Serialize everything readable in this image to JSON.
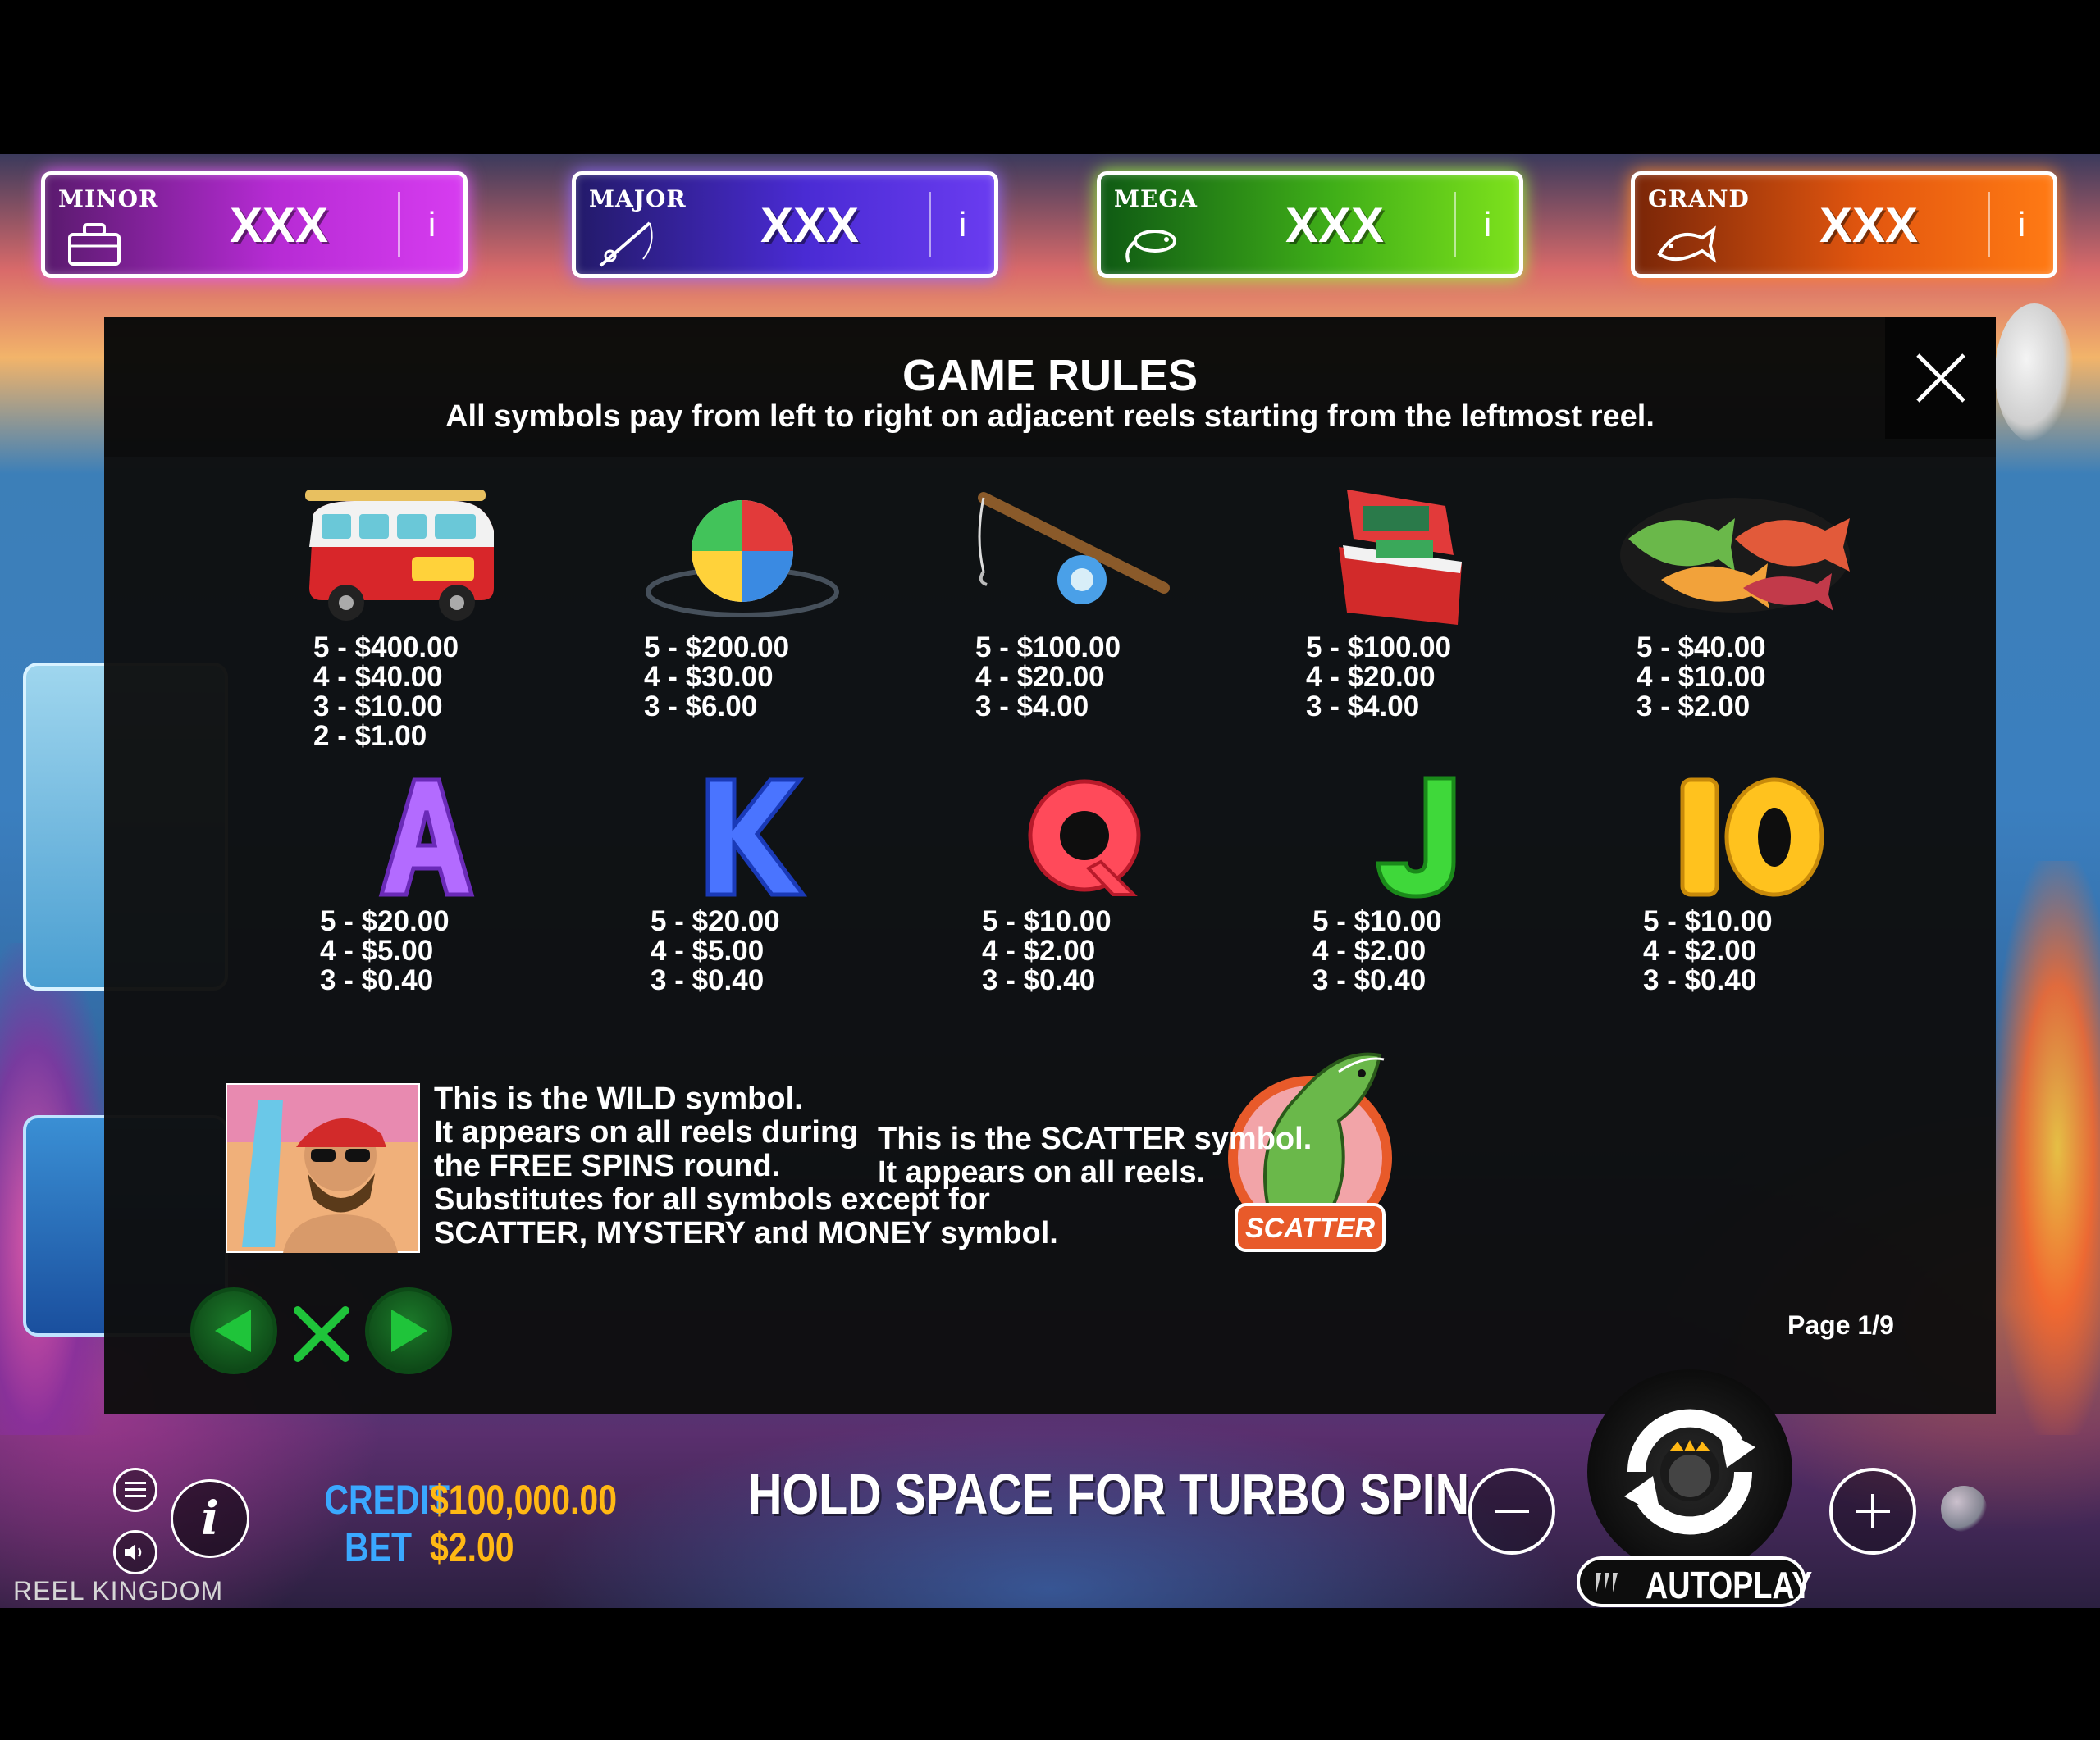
{
  "jackpots": [
    {
      "name": "MINOR",
      "value": "XXX",
      "info": "i",
      "icon": "tackle-box-icon"
    },
    {
      "name": "MAJOR",
      "value": "XXX",
      "info": "i",
      "icon": "fishing-rod-icon"
    },
    {
      "name": "MEGA",
      "value": "XXX",
      "info": "i",
      "icon": "fishing-lure-icon"
    },
    {
      "name": "GRAND",
      "value": "XXX",
      "info": "i",
      "icon": "fish-icon"
    }
  ],
  "rules": {
    "title": "GAME RULES",
    "subtitle": "All symbols pay from left to right on adjacent reels starting from the leftmost reel.",
    "close_icon": "close-icon",
    "symbols_row1": [
      {
        "name": "van",
        "pays": [
          "5 - $400.00",
          "4 - $40.00",
          "3 - $10.00",
          "2 - $1.00"
        ]
      },
      {
        "name": "beach-ball",
        "pays": [
          "5 - $200.00",
          "4 - $30.00",
          "3 - $6.00"
        ]
      },
      {
        "name": "fishing-rod",
        "pays": [
          "5 - $100.00",
          "4 - $20.00",
          "3 - $4.00"
        ]
      },
      {
        "name": "tackle-box",
        "pays": [
          "5 - $100.00",
          "4 - $20.00",
          "3 - $4.00"
        ]
      },
      {
        "name": "fish",
        "pays": [
          "5 - $40.00",
          "4 - $10.00",
          "3 - $2.00"
        ]
      }
    ],
    "symbols_row2": [
      {
        "name": "A",
        "pays": [
          "5 - $20.00",
          "4 - $5.00",
          "3 - $0.40"
        ],
        "color": "#b36bff"
      },
      {
        "name": "K",
        "pays": [
          "5 - $20.00",
          "4 - $5.00",
          "3 - $0.40"
        ],
        "color": "#4a74ff"
      },
      {
        "name": "Q",
        "pays": [
          "5 - $10.00",
          "4 - $2.00",
          "3 - $0.40"
        ],
        "color": "#ff4a5a"
      },
      {
        "name": "J",
        "pays": [
          "5 - $10.00",
          "4 - $2.00",
          "3 - $0.40"
        ],
        "color": "#3fd83a"
      },
      {
        "name": "10",
        "pays": [
          "5 - $10.00",
          "4 - $2.00",
          "3 - $0.40"
        ],
        "color": "#ffc21e"
      }
    ],
    "wild": {
      "lines": [
        "This is the WILD symbol.",
        "It appears on all reels during",
        "the FREE SPINS round.",
        "Substitutes for all symbols except for",
        "SCATTER, MYSTERY and MONEY symbol."
      ]
    },
    "scatter": {
      "badge": "SCATTER",
      "lines": [
        "This is the SCATTER symbol.",
        "It appears on all reels."
      ]
    },
    "page": "Page 1/9"
  },
  "bottom": {
    "credit_label": "CREDIT",
    "credit_value": "$100,000.00",
    "bet_label": "BET",
    "bet_value": "$2.00",
    "turbo_hint": "HOLD SPACE FOR TURBO SPIN",
    "autoplay_label": "AUTOPLAY",
    "brand": "REEL KINGDOM",
    "info_glyph": "i"
  },
  "colors": {
    "minor": "#c832e6",
    "major": "#5a36e0",
    "mega": "#5fc81a",
    "grand": "#f06414",
    "credit_label": "#3aa8ff",
    "credit_value": "#ffb814",
    "nav_green": "#1fc43a"
  }
}
